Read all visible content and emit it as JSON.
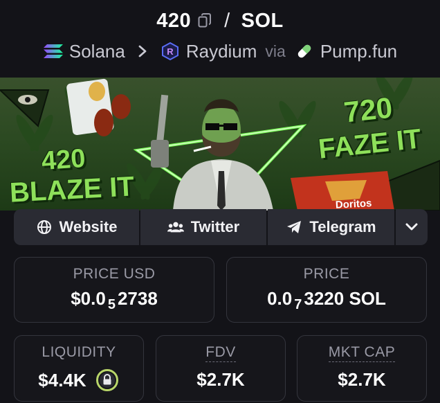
{
  "header": {
    "token_symbol": "420",
    "separator": "/",
    "quote_symbol": "SOL"
  },
  "breadcrumb": {
    "chain": "Solana",
    "dex": "Raydium",
    "via": "via",
    "launchpad": "Pump.fun"
  },
  "banner": {
    "left_line1": "420",
    "left_line2": "BLAZE IT",
    "right_line1": "720",
    "right_line2": "FAZE IT",
    "colors": {
      "text": "#8ee05a",
      "laser": "#7dff5a"
    }
  },
  "links": {
    "website": {
      "label": "Website",
      "icon": "globe-icon"
    },
    "twitter": {
      "label": "Twitter",
      "icon": "users-icon"
    },
    "telegram": {
      "label": "Telegram",
      "icon": "paper-plane-icon"
    },
    "more": {
      "icon": "chevron-down-icon"
    }
  },
  "stats": {
    "price_usd": {
      "label": "PRICE USD",
      "prefix": "$0.0",
      "zeros": "5",
      "digits": "2738"
    },
    "price": {
      "label": "PRICE",
      "prefix": "0.0",
      "zeros": "7",
      "digits": "3220 SOL"
    },
    "liquidity": {
      "label": "LIQUIDITY",
      "value": "$4.4K",
      "icon": "lock-icon",
      "icon_color": "#b9d66a"
    },
    "fdv": {
      "label": "FDV",
      "value": "$2.7K"
    },
    "mkt_cap": {
      "label": "MKT CAP",
      "value": "$2.7K"
    }
  }
}
